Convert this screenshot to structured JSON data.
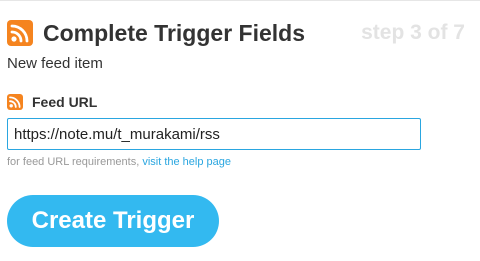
{
  "header": {
    "icon": "rss-icon",
    "title": "Complete Trigger Fields",
    "step": "step 3 of 7"
  },
  "subtitle": "New feed item",
  "field": {
    "icon": "rss-icon",
    "label": "Feed URL",
    "value": "https://note.mu/t_murakami/rss"
  },
  "help": {
    "prefix": "for feed URL requirements,",
    "link_text": "visit the help page"
  },
  "actions": {
    "create_label": "Create Trigger"
  },
  "colors": {
    "rss": "#f5841f",
    "accent": "#33b9f0",
    "link": "#2aa6e0",
    "step_text": "#e3e3e3"
  }
}
